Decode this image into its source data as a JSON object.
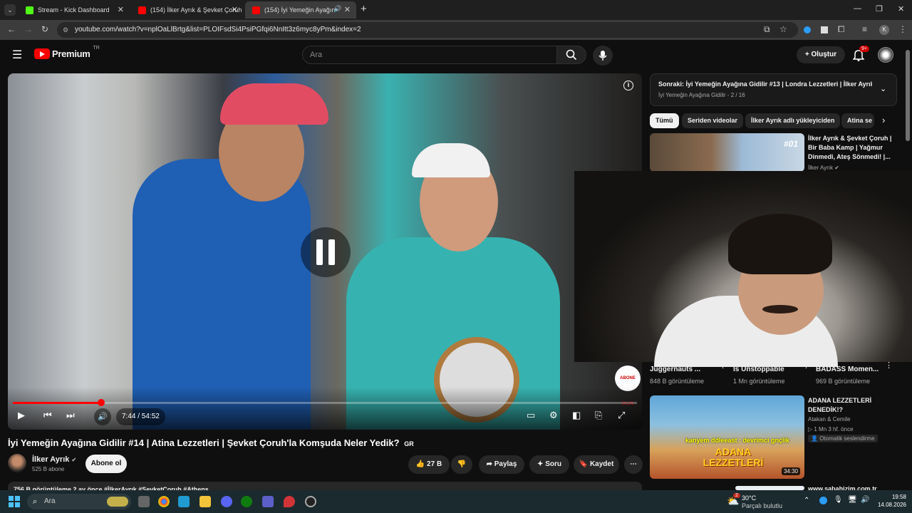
{
  "browser": {
    "tabs": [
      {
        "title": "Stream - Kick Dashboard",
        "favicon_color": "#53fc18"
      },
      {
        "title": "(154) İlker Ayrık & Şevket Çoruh",
        "favicon_color": "#ff0000"
      },
      {
        "title": "(154) İyi Yemeğin Ayağına G",
        "favicon_color": "#ff0000"
      }
    ],
    "url": "youtube.com/watch?v=nplOaLlBrtg&list=PLOIFsdSi4PsiPGfqi6NnItt3z6myc8yPm&index=2",
    "profile_letter": "K"
  },
  "header": {
    "logo_text": "Premium",
    "logo_region": "TR",
    "search_placeholder": "Ara",
    "create_label": "Oluştur",
    "notifications_badge": "9+"
  },
  "player": {
    "time": "7:44 / 54:52",
    "progress_fraction": 0.141,
    "watermark_text": "ABONE OLUN"
  },
  "video": {
    "title": "İyi Yemeğin Ayağına Gidilir #14 | Atina Lezzetleri | Şevket Çoruh'la Komşuda Neler Yedik?",
    "title_badge": "GR",
    "channel_name": "İlker Ayrık",
    "subscribers": "525 B abone",
    "subscribe_label": "Abone ol",
    "like_count": "27 B",
    "share_label": "Paylaş",
    "ask_label": "Soru",
    "save_label": "Kaydet",
    "description_line": "756 B görüntüleme  2 ay önce  #İlkerAyrık #ŞevketÇoruh #Athens"
  },
  "playlist": {
    "next_title": "Sonraki: İyi Yemeğin Ayağına Gidilir #13 | Londra Lezzetleri | İlker Ayrık'...",
    "subtitle": "İyi Yemeğin Ayağına Gidilir - 2 / 16"
  },
  "chips": [
    "Tümü",
    "Seriden videolar",
    "İlker Ayrık adlı yükleyiciden",
    "Atina se"
  ],
  "related": [
    {
      "title": "İlker Ayrık & Şevket Çoruh | Bir Baba Kamp | Yağmur Dinmedi, Ateş Sönmedi! |...",
      "channel": "İlker Ayrık",
      "badge": "#01"
    },
    {
      "title": "ADANA LEZZETLERİ DENEDİK!?",
      "channel": "Atakan & Cemile",
      "meta": "1 Mn  3 hf. önce",
      "audio": "Otomatik seslendirme",
      "duration": "34:30",
      "thumb_text_top": "kanyem ddleeast : devrimci gnçlik",
      "thumb_text_big": "ADANA LEZZETLERİ"
    },
    {
      "title": "www.sabahizim.com.tr"
    }
  ],
  "shorts": [
    {
      "title": "Juggernauts ...",
      "views": "848 B görüntüleme"
    },
    {
      "title": "Is Unstoppable",
      "views": "1 Mn görüntüleme"
    },
    {
      "title": "BADASS Momen...",
      "views": "969 B görüntüleme"
    }
  ],
  "taskbar": {
    "search_placeholder": "Ara",
    "weather_temp": "30°C",
    "weather_desc": "Parçalı bulutlu",
    "weather_badge": "2",
    "time": "19:58",
    "date": "14.08.2026"
  }
}
